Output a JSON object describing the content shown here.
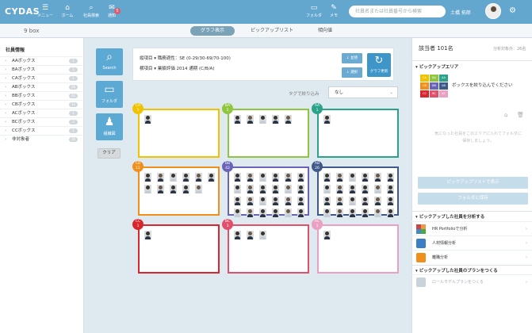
{
  "app": {
    "logo": "CYDAS"
  },
  "nav": [
    {
      "icon": "☰",
      "label": "メニュー"
    },
    {
      "icon": "⌂",
      "label": "ホーム"
    },
    {
      "icon": "⌕",
      "label": "社員検索"
    },
    {
      "icon": "✉",
      "label": "通知",
      "badge": "5"
    }
  ],
  "header_right": {
    "folder_label": "フォルダ",
    "memo_label": "メモ",
    "search_placeholder": "社員名または社員番号から検索",
    "user_name": "土橋 拓郎",
    "gear": "⚙"
  },
  "page_title": "9 box",
  "tabs": [
    {
      "label": "グラフ表示",
      "active": true
    },
    {
      "label": "ピックアップリスト",
      "active": false
    },
    {
      "label": "傾向値",
      "active": false
    }
  ],
  "left_panel": {
    "header": "社員情報",
    "items": [
      {
        "label": "AAボックス",
        "count": "1"
      },
      {
        "label": "BAボックス",
        "count": "5"
      },
      {
        "label": "CAボックス",
        "count": "1"
      },
      {
        "label": "ABボックス",
        "count": "26"
      },
      {
        "label": "BBボックス",
        "count": "42"
      },
      {
        "label": "CBボックス",
        "count": "11"
      },
      {
        "label": "ACボックス",
        "count": "1"
      },
      {
        "label": "BCボックス",
        "count": "3"
      },
      {
        "label": "CCボックス",
        "count": "1"
      },
      {
        "label": "非対象者",
        "count": "26"
      }
    ]
  },
  "tools": [
    {
      "icon": "⌕",
      "label": "Search"
    },
    {
      "icon": "▭",
      "label": "フォルダ"
    },
    {
      "icon": "♟",
      "label": "組織図"
    }
  ],
  "clear_label": "クリア",
  "axis": {
    "vertical_label": "縦項目",
    "vertical_value": "職務適性：SE (0-29/30-69/70-100)",
    "horizontal_label": "横項目",
    "horizontal_value": "業績評価 2014 通期 (C/B/A)",
    "sort_label": "並替",
    "select_label": "選択",
    "update_label": "グラフ更新"
  },
  "tag_filter": {
    "label": "タグで絞り込み",
    "value": "なし"
  },
  "boxes": [
    {
      "code": "CA",
      "count": "1",
      "color": "#f0c200",
      "photos": 1
    },
    {
      "code": "BA",
      "count": "5",
      "color": "#8fc63f",
      "photos": 5
    },
    {
      "code": "AA",
      "count": "1",
      "color": "#2aa38a",
      "photos": 1
    },
    {
      "code": "CB",
      "count": "11",
      "color": "#f08f1b",
      "photos": 11
    },
    {
      "code": "BB",
      "count": "42",
      "color": "#6a64b8",
      "photos": 24
    },
    {
      "code": "AB",
      "count": "26",
      "color": "#3f5a8a",
      "photos": 24
    },
    {
      "code": "CC",
      "count": "1",
      "color": "#d7262e",
      "photos": 1
    },
    {
      "code": "BC",
      "count": "3",
      "color": "#e0506a",
      "photos": 3
    },
    {
      "code": "AC",
      "count": "1",
      "color": "#e9a0c3",
      "photos": 1
    }
  ],
  "right_panel": {
    "title": "該当者 101名",
    "sub": "分析対象外：26名",
    "pickup_area": "ピックアップエリア",
    "drop_text": "ボックスを絞り込んでください",
    "hint": "気になった社員をこのエリアに入れてフォルダに保存しましょう。",
    "show_button": "ピックアップリストで表示",
    "save_button": "フォルダに保存",
    "analyze_header": "ピックアップした社員を分析する",
    "analyze_items": [
      "HR Portfolioで分析",
      "人材情報分析",
      "離職分析"
    ],
    "plan_header": "ピックアップした社員のプランをつくる",
    "plan_item": "ロールモデルプランをつくる"
  },
  "mini_grid": [
    "CA",
    "BA",
    "AA",
    "CB",
    "BB",
    "AB",
    "CC",
    "BC",
    "AC"
  ]
}
